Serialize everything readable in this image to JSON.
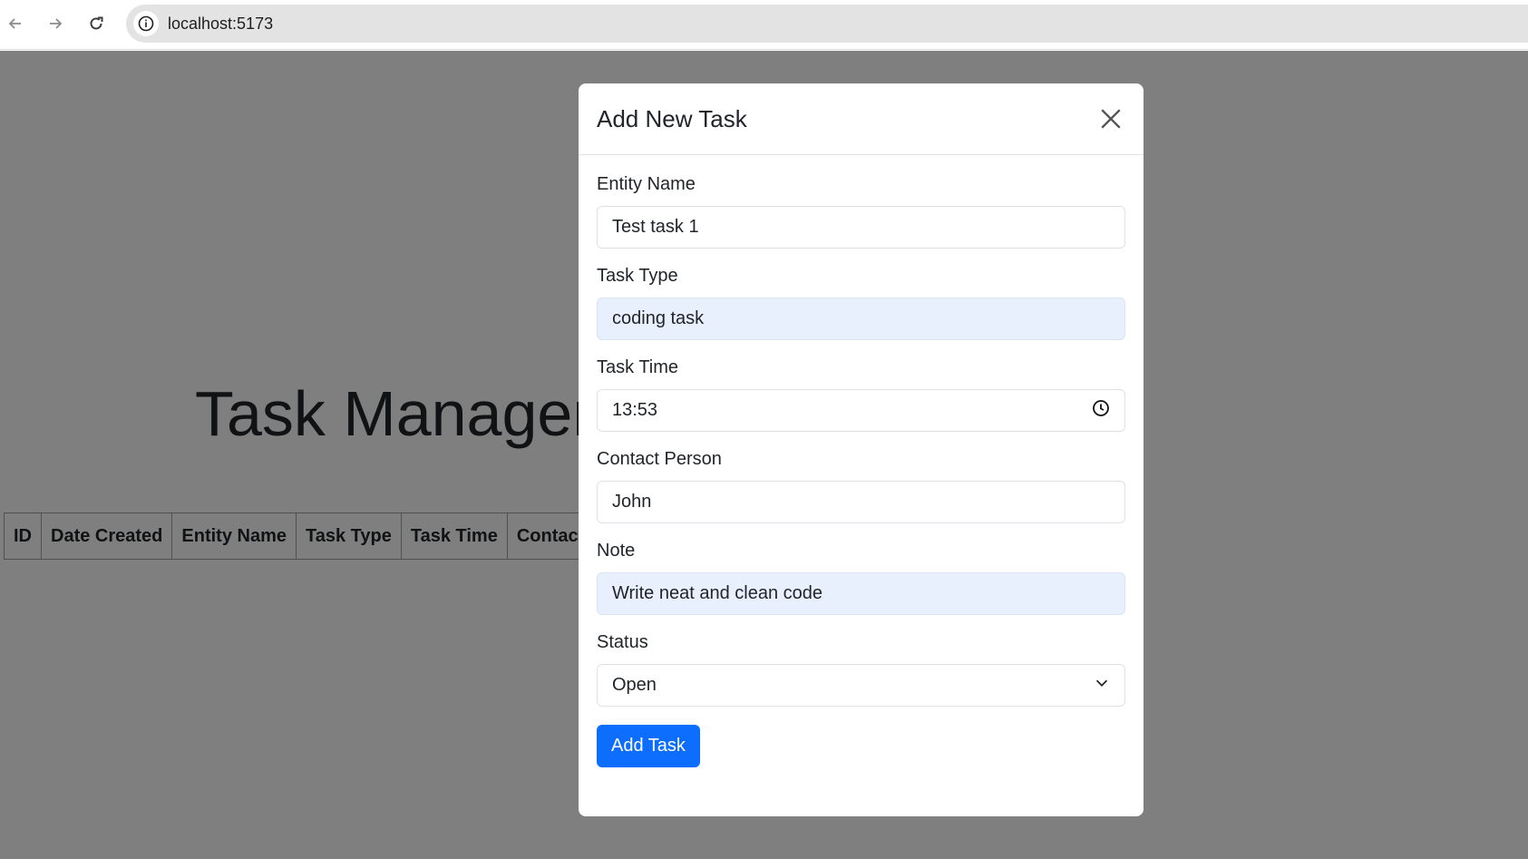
{
  "browser": {
    "url": "localhost:5173"
  },
  "page": {
    "title": "Task Managem",
    "table_headers": [
      "ID",
      "Date Created",
      "Entity Name",
      "Task Type",
      "Task Time",
      "Contact"
    ]
  },
  "modal": {
    "title": "Add New Task",
    "fields": [
      {
        "label": "Entity Name",
        "value": "Test task 1"
      },
      {
        "label": "Task Type",
        "value": "coding task"
      },
      {
        "label": "Task Time",
        "value": "13:53"
      },
      {
        "label": "Contact Person",
        "value": "John"
      },
      {
        "label": "Note",
        "value": "Write neat and clean code"
      },
      {
        "label": "Status",
        "value": "Open"
      }
    ],
    "submit_label": "Add Task"
  },
  "colors": {
    "primary": "#0d6efd",
    "autofill": "#e8f0fe",
    "backdrop": "rgba(0,0,0,0.5)"
  }
}
